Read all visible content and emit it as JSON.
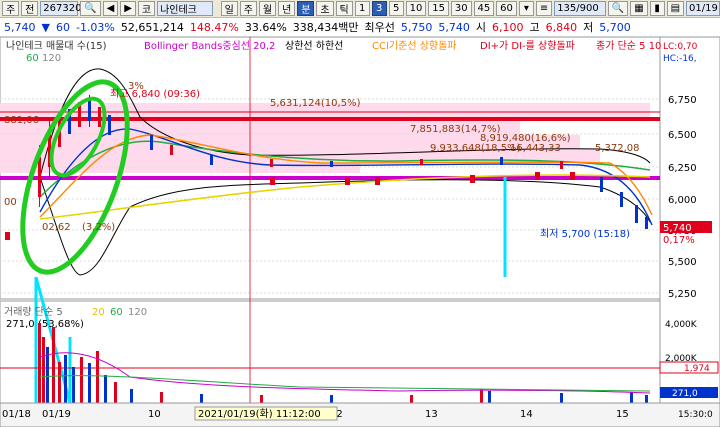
{
  "toolbar": {
    "type_btn": "주",
    "prev_btn": "전",
    "code": "267320",
    "stock_btn": "코",
    "stock_name": "나인테크",
    "period_day": "일",
    "period_week": "주",
    "period_month": "월",
    "period_year": "년",
    "period_min": "분",
    "period_sec": "초",
    "period_tick": "틱",
    "intervals": [
      "1",
      "3",
      "5",
      "10",
      "15",
      "30",
      "45",
      "60"
    ],
    "active_interval": "3",
    "count": "135/900",
    "date": "01/19"
  },
  "info": {
    "price": "5,740",
    "arrow": "▼",
    "change": "60",
    "change_pct": "-1.03%",
    "volume": "52,651,214",
    "volume_ratio": "148.47%",
    "turnover": "33.64%",
    "amount": "338,434백만",
    "best_bid_label": "최우선",
    "bid1": "5,750",
    "bid2": "5,740",
    "open_label": "시",
    "open": "6,100",
    "high_label": "고",
    "high": "6,840",
    "low_label": "저",
    "low": "5,700"
  },
  "legend": {
    "main": "나인테크 매물대 수(15)",
    "bollinger": "Bollinger Bands중심선 20,2",
    "limits": "상한선 하한선",
    "cci": "CCI기준선 상향돌파",
    "dmi": "DI+가 DI-를 상향돌파",
    "ma": "종가 단순 5 10",
    "sub_60": "60",
    "sub_120": "120",
    "right_top": "LC:0,70",
    "right_top2": "HC:-16,"
  },
  "annotations": {
    "high": "최고 6,840 (09:36)",
    "low": "최저 5,700 (15:18)",
    "vol_a": "5,631,124(10,5%)",
    "vol_b": "7,851,883(14,7%)",
    "vol_c": "8,919,480(16,6%)",
    "vol_d": "9,933,648(18,5%)",
    "vol_e": "16,443,33",
    "vol_f": "5,372,08",
    "vol_g": "02,62",
    "vol_h": "(3,2%)",
    "vol_i": "3%",
    "left_a": "881,06",
    "left_b": "00",
    "vol_legend": "거래량 단순 5",
    "vol_legend_20": "20",
    "vol_legend_60": "60",
    "vol_legend_120": "120",
    "vol_value": "271,0",
    "vol_value_pct": "(53,68%)",
    "crosshair_time": "2021/01/19(화) 11:12:00"
  },
  "price_axis": {
    "ticks": [
      "6,750",
      "6,500",
      "6,250",
      "6,000",
      "5,750",
      "5,500",
      "5,250"
    ],
    "current": "5,740",
    "current_pct": "0,17%",
    "vol_ticks": [
      "4,000K",
      "2,000K"
    ],
    "vol_level": "1,974",
    "vol_current": "271,0",
    "time_label": "15:30:0"
  },
  "time_axis": {
    "labels": [
      "01/18",
      "01/19",
      "10",
      "11",
      "12",
      "13",
      "14",
      "15"
    ]
  },
  "colors": {
    "red": "#e0001b",
    "blue": "#0033cc",
    "magenta": "#cc00cc",
    "pink_band": "#ffd9ec",
    "green_mark": "#22cc22",
    "cyan_mark": "#00e5ff"
  }
}
